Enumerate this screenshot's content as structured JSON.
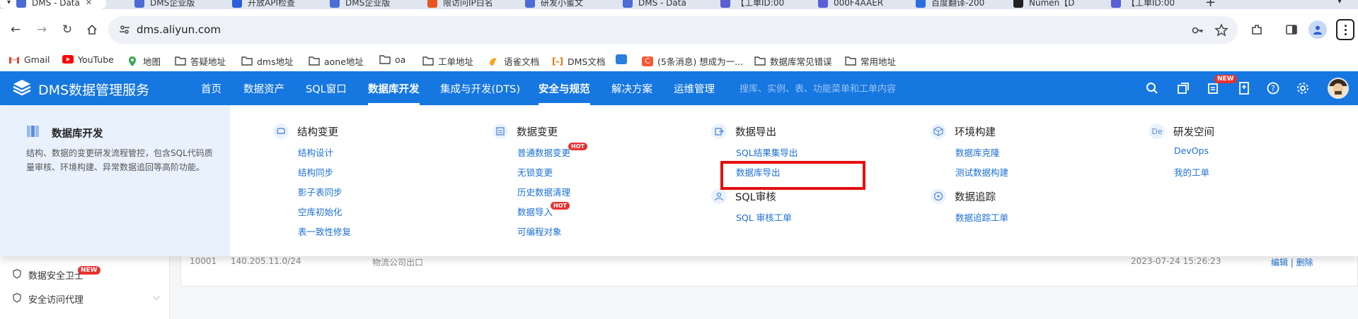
{
  "browser": {
    "tabs": [
      {
        "label": "DMS - Data",
        "color": "#4b6cd6",
        "active": true
      },
      {
        "label": "DMS企业版",
        "color": "#4b6cd6"
      },
      {
        "label": "开放API检查",
        "color": "#2b5fd9"
      },
      {
        "label": "DMS企业版",
        "color": "#4b6cd6"
      },
      {
        "label": "限访问IP白名",
        "color": "#e8561f"
      },
      {
        "label": "研发小蜜文",
        "color": "#4b6cd6"
      },
      {
        "label": "DMS - Data",
        "color": "#4b6cd6"
      },
      {
        "label": "【工单ID:00",
        "color": "#5a5fd6"
      },
      {
        "label": "000F4AAER",
        "color": "#5a5fd6"
      },
      {
        "label": "百度翻译-200",
        "color": "#2b6de0"
      },
      {
        "label": "Numen【D",
        "color": "#222222"
      },
      {
        "label": "【工单ID:00",
        "color": "#5a5fd6"
      }
    ],
    "url": "dms.aliyun.com",
    "bookmarks": [
      {
        "label": "Gmail",
        "icon": "gmail-icon"
      },
      {
        "label": "YouTube",
        "icon": "youtube-icon"
      },
      {
        "label": "地图",
        "icon": "maps-icon"
      },
      {
        "label": "答疑地址",
        "icon": "folder-icon"
      },
      {
        "label": "dms地址",
        "icon": "folder-icon"
      },
      {
        "label": "aone地址",
        "icon": "folder-icon"
      },
      {
        "label": "oa",
        "icon": "folder-icon"
      },
      {
        "label": "工单地址",
        "icon": "folder-icon"
      },
      {
        "label": "语雀文档",
        "icon": "yuque-icon"
      },
      {
        "label": "DMS文档",
        "icon": "aliyun-icon"
      },
      {
        "label": "",
        "icon": "app-icon"
      },
      {
        "label": "(5条消息) 想成为一...",
        "icon": "csdn-icon"
      },
      {
        "label": "数据库常见错误",
        "icon": "folder-icon"
      },
      {
        "label": "常用地址",
        "icon": "folder-icon"
      }
    ]
  },
  "dms": {
    "logo": "DMS数据管理服务",
    "menu": [
      "首页",
      "数据资产",
      "SQL窗口",
      "数据库开发",
      "集成与开发(DTS)",
      "安全与规范",
      "解决方案",
      "运维管理"
    ],
    "search_placeholder": "搜库、实例、表、功能菜单和工单内容",
    "new_badge": "NEW"
  },
  "dropdown": {
    "title": "数据库开发",
    "description": "结构、数据的变更研发流程管控，包含SQL代码质量审核、环境构建、异常数据追回等高阶功能。",
    "groups": {
      "schema": {
        "title": "结构变更",
        "links": [
          "结构设计",
          "结构同步",
          "影子表同步",
          "空库初始化",
          "表一致性修复"
        ]
      },
      "data": {
        "title": "数据变更",
        "links": [
          "普通数据变更",
          "无锁变更",
          "历史数据清理",
          "数据导入",
          "可编程对象"
        ],
        "hot": "HOT"
      },
      "export": {
        "title": "数据导出",
        "links": [
          "SQL结果集导出",
          "数据库导出"
        ]
      },
      "audit": {
        "title": "SQL审核",
        "links": [
          "SQL 审核工单"
        ]
      },
      "env": {
        "title": "环境构建",
        "links": [
          "数据库克隆",
          "测试数据构建"
        ]
      },
      "trace": {
        "title": "数据追踪",
        "links": [
          "数据追踪工单"
        ]
      },
      "devspace": {
        "title": "研发空间",
        "links": [
          "DevOps",
          "我的工单"
        ],
        "icon_text": "De"
      }
    }
  },
  "background": {
    "sidebar": [
      "数据安全卫士",
      "安全访问代理"
    ],
    "new_badge": "NEW",
    "row": {
      "id": "10001",
      "ip": "140.205.11.0/24",
      "desc": "物流公司出口",
      "time": "2023-07-24 15:26:23",
      "action": "编辑 | 删除"
    }
  }
}
